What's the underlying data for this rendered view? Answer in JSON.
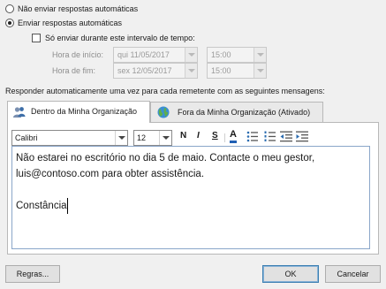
{
  "options": {
    "no_auto_reply": "Não enviar respostas automáticas",
    "send_auto_reply": "Enviar respostas automáticas",
    "time_range_check": "Só enviar durante este intervalo de tempo:",
    "start_time_label": "Hora de início:",
    "end_time_label": "Hora de fim:",
    "start_date": "qui 11/05/2017",
    "start_hour": "15:00",
    "end_date": "sex 12/05/2017",
    "end_hour": "15:00"
  },
  "reply_instruction": "Responder automaticamente uma vez para cada remetente com as seguintes mensagens:",
  "tabs": [
    {
      "label": "Dentro da Minha Organização",
      "icon": "people-icon"
    },
    {
      "label": "Fora da Minha Organização (Ativado)",
      "icon": "globe-icon"
    }
  ],
  "toolbar": {
    "font": "Calibri",
    "size": "12",
    "bold": "N",
    "italic": "I",
    "underline": "S",
    "font_color": "A"
  },
  "message": {
    "line1": "Não estarei no escritório no dia 5 de maio. Contacte o meu gestor,",
    "line2": "luis@contoso.com para obter assistência.",
    "line3": "",
    "line4": "Constância"
  },
  "buttons": {
    "rules": "Regras...",
    "ok": "OK",
    "cancel": "Cancelar"
  },
  "colors": {
    "font_color_bar": "#1f5fb4",
    "editor_border": "#8aa6c9"
  }
}
